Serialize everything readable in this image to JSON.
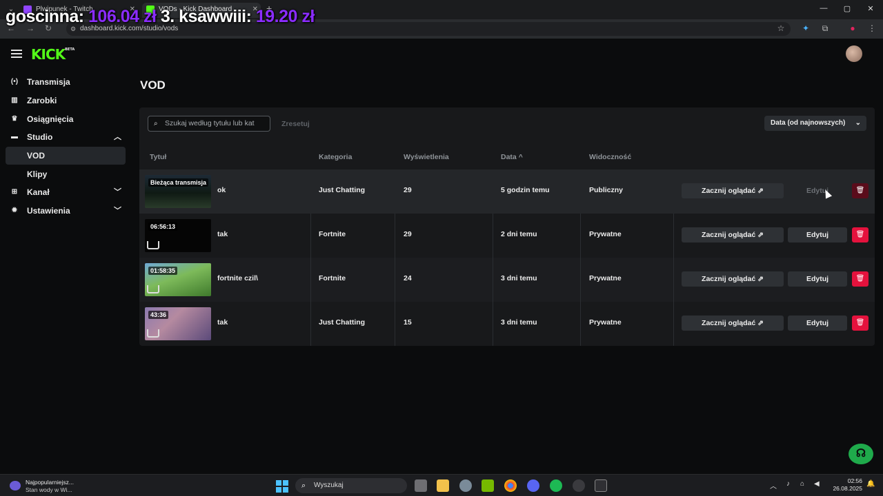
{
  "browser": {
    "tabs": [
      {
        "title": "Plwipunek - Twitch"
      },
      {
        "title": "VODs - Kick Dashboard"
      }
    ],
    "url": "dashboard.kick.com/studio/vods"
  },
  "overlay": {
    "text1": "goscinna:",
    "amount1": "106.04 zł",
    "text2": "3. ksawwiii:",
    "amount2": "19.20 zł"
  },
  "app": {
    "logo": "KICK",
    "logo_badge": "BETA"
  },
  "sidebar": {
    "items": [
      {
        "label": "Transmisja",
        "icon": "broadcast-icon"
      },
      {
        "label": "Zarobki",
        "icon": "earnings-icon"
      },
      {
        "label": "Osiągnięcia",
        "icon": "trophy-icon"
      },
      {
        "label": "Studio",
        "icon": "studio-icon",
        "expanded": true
      },
      {
        "label": "VOD",
        "active": true
      },
      {
        "label": "Klipy"
      },
      {
        "label": "Kanał",
        "icon": "channel-icon",
        "expanded": false
      },
      {
        "label": "Ustawienia",
        "icon": "gear-icon",
        "expanded": false
      }
    ]
  },
  "page": {
    "title": "VOD",
    "search_placeholder": "Szukaj według tytułu lub kat",
    "reset_label": "Zresetuj",
    "sort_label": "Data (od najnowszych)"
  },
  "table": {
    "headers": {
      "title": "Tytuł",
      "category": "Kategoria",
      "views": "Wyświetlenia",
      "date": "Data",
      "visibility": "Widoczność"
    },
    "watch_label": "Zacznij oglądać",
    "edit_label": "Edytuj",
    "rows": [
      {
        "thumb_label": "Bieżąca transmisja",
        "title": "ok",
        "category": "Just Chatting",
        "views": "29",
        "date": "5 godzin temu",
        "visibility": "Publiczny"
      },
      {
        "thumb_label": "06:56:13",
        "title": "tak",
        "category": "Fortnite",
        "views": "29",
        "date": "2 dni temu",
        "visibility": "Prywatne"
      },
      {
        "thumb_label": "01:58:35",
        "title": "fortnite czil\\",
        "category": "Fortnite",
        "views": "24",
        "date": "3 dni temu",
        "visibility": "Prywatne"
      },
      {
        "thumb_label": "43:36",
        "title": "tak",
        "category": "Just Chatting",
        "views": "15",
        "date": "3 dni temu",
        "visibility": "Prywatne"
      }
    ]
  },
  "taskbar": {
    "news_line1": "Najpopularniejsz...",
    "news_line2": "Stan wody w Wi...",
    "search_placeholder": "Wyszukaj",
    "time": "02:56",
    "date": "26.08.2025"
  },
  "colors": {
    "accent": "#53fc18",
    "delete": "#e4123d",
    "overlay_amount": "#8b2cff"
  }
}
